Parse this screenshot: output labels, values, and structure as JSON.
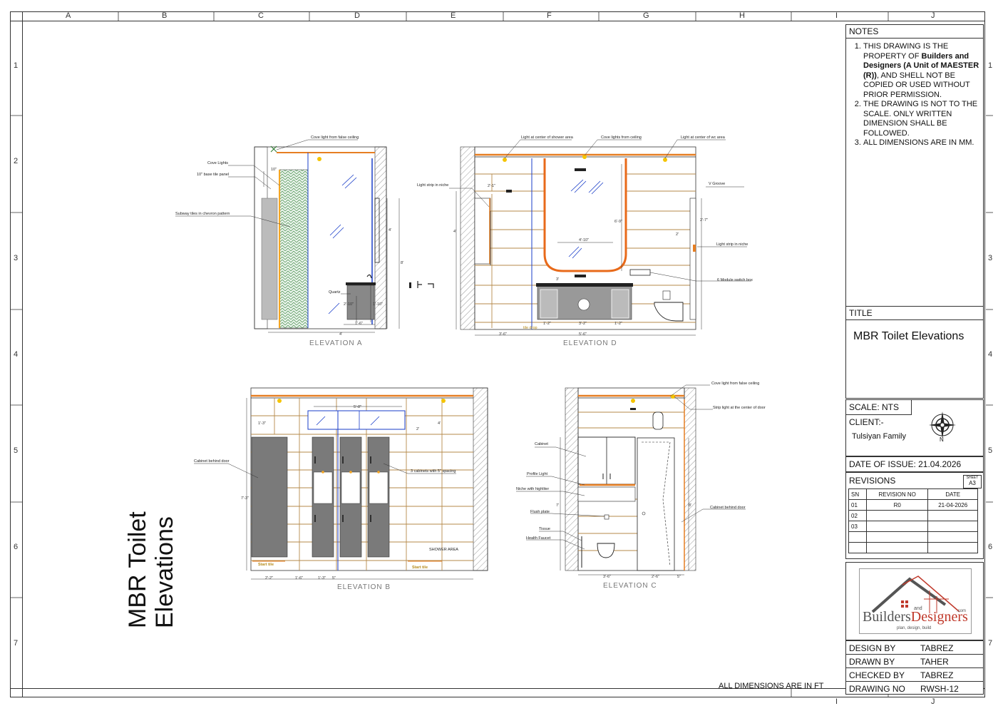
{
  "grid": {
    "columns": [
      "A",
      "B",
      "C",
      "D",
      "E",
      "F",
      "G",
      "H",
      "I",
      "J"
    ],
    "rows": [
      "1",
      "2",
      "3",
      "4",
      "5",
      "6",
      "7"
    ]
  },
  "notes": {
    "heading": "NOTES",
    "item1_prefix": "THIS DRAWING IS THE PROPERTY OF ",
    "item1_bold": "Builders and Designers (A Unit of MAESTER (R))",
    "item1_suffix": ",  AND SHELL NOT BE COPIED OR USED WITHOUT PRIOR PERMISSION.",
    "item2": "THE DRAWING  IS NOT TO THE SCALE. ONLY WRITTEN DIMENSION SHALL BE FOLLOWED.",
    "item3": "ALL DIMENSIONS ARE IN MM."
  },
  "title_block": {
    "title_heading": "TITLE",
    "title": "MBR Toilet Elevations",
    "scale": "SCALE: NTS",
    "client_label": "CLIENT:-",
    "client": "Tulsiyan Family",
    "north": "N",
    "date_of_issue": "DATE OF ISSUE:  21.04.2026",
    "revisions_label": "REVISIONS",
    "sheet_label": "SHEET",
    "sheet": "A3",
    "rev_headers": [
      "SN",
      "REVISION NO",
      "DATE"
    ],
    "rev_rows": [
      [
        "01",
        "R0",
        "21-04-2026"
      ],
      [
        "02",
        "",
        ""
      ],
      [
        "03",
        "",
        ""
      ],
      [
        "",
        "",
        ""
      ],
      [
        "",
        "",
        ""
      ]
    ],
    "logo_text_a": "Builders",
    "logo_text_b": "Designers",
    "logo_and": "and",
    "logo_com": ".com",
    "logo_tagline": "plan, design, build",
    "design_by_label": "DESIGN BY",
    "design_by": "TABREZ",
    "drawn_by_label": "DRAWN BY",
    "drawn_by": "TAHER",
    "checked_by_label": "CHECKED BY",
    "checked_by": "TABREZ",
    "drawing_no_label": "DRAWING NO",
    "drawing_no": "RWSH-12"
  },
  "sheet_title_line1": "MBR Toilet",
  "sheet_title_line2": "Elevations",
  "dimensions_note": "ALL DIMENSIONS ARE IN  FT",
  "elevations": {
    "a": {
      "title": "ELEVATION  A",
      "labels": [
        "Cove light from false ceiling",
        "Cove Lights",
        "10\" base tile panel",
        "Subway tiles in chevron pattern",
        "Quartz"
      ],
      "dims": [
        "10\"",
        "1'-6\"",
        "4'",
        "4'",
        "8'",
        "2'-10\"",
        "1'-10\""
      ]
    },
    "d": {
      "title": "ELEVATION  D",
      "labels": [
        "Light at center of shower area",
        "Cove lights from ceiling",
        "Light at center of wc area",
        "Light strip in niche",
        "V Groove",
        "Light strip in niche",
        "6 Module switch box",
        "tile drop"
      ],
      "dims": [
        "2'-1\"",
        "4'-10\"",
        "6'-9\"",
        "3'-6\"",
        "5'-6\"",
        "1'-2\"",
        "3'-2\"",
        "1'-2\"",
        "3'",
        "2'",
        "2'-7\"",
        "4'"
      ]
    },
    "b": {
      "title": "ELEVATION  B",
      "labels": [
        "Cabinet behind door",
        "3 cabinets with 5\" spacing",
        "SHOWER AREA",
        "Start tile",
        "Start tile"
      ],
      "dims": [
        "5'-8\"",
        "1'-3\"",
        "4'",
        "2'",
        "7'-3\"",
        "2'-2\"",
        "1'-6\"",
        "1'-3\"",
        "5\""
      ]
    },
    "c": {
      "title": "ELEVATION  C",
      "labels": [
        "Cove light from false ceiling",
        "Strip light  at the center of door",
        "Cabinet",
        "Profile Light",
        "Niche with highliter",
        "Flush plate",
        "Tissue",
        "Health Faucet",
        "Cabinet behind door"
      ],
      "dims": [
        "3'-6\"",
        "2'-6\"",
        "5\"",
        "7'",
        "8'"
      ]
    }
  }
}
